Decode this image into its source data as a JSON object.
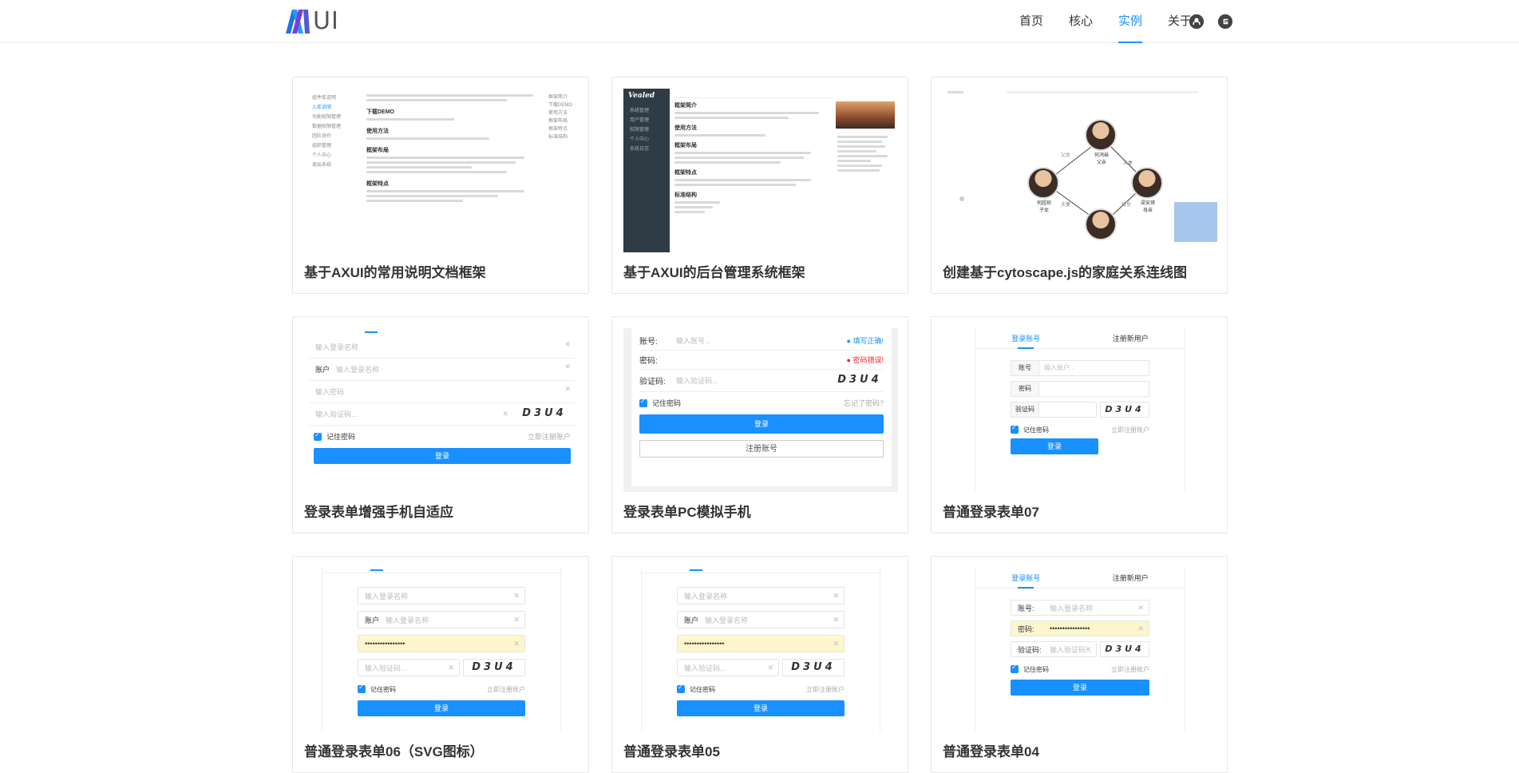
{
  "header": {
    "logo_text": "UI",
    "nav": [
      "首页",
      "核心",
      "实例",
      "关于"
    ],
    "active_nav": "实例"
  },
  "cards": [
    {
      "title": "基于AXUI的常用说明文档框架",
      "thumb": {
        "menu": [
          "组件库说明",
          "入库说明",
          "功能权限管理",
          "数据权限管理",
          "团队协作",
          "组织管理",
          "个人中心",
          "退出系统"
        ],
        "headings": [
          "下载DEMO",
          "使用方法",
          "框架布局",
          "框架特点"
        ],
        "right_menu": [
          "框架简介",
          "下载DEMO",
          "使用方法",
          "框架布局",
          "框架特点",
          "标准结构"
        ]
      }
    },
    {
      "title": "基于AXUI的后台管理系统框架",
      "thumb": {
        "brand": "Vealed",
        "headings": [
          "框架简介",
          "使用方法",
          "框架布局",
          "框架特点",
          "标准结构"
        ],
        "side_items": [
          "系统管理",
          "用户管理",
          "权限管理",
          "个人中心",
          "系统日志"
        ]
      }
    },
    {
      "title": "创建基于cytoscape.js的家庭关系连线图",
      "thumb": {
        "names": [
          "何鸿燊\n父亲",
          "何超琼\n子女",
          "梁安琪\n母亲"
        ],
        "edges": [
          "父女",
          "夫妻",
          "母女",
          "夫妻"
        ]
      }
    },
    {
      "title": "登录表单增强手机自适应",
      "thumb": {
        "fields": [
          "输入登录名称",
          "输入登录名称",
          "输入密码",
          "输入验证码..."
        ],
        "account_prefix": "账户",
        "captcha": "D3U4",
        "remember": "记住密码",
        "register": "立即注册账户",
        "login": "登录"
      }
    },
    {
      "title": "登录表单PC模拟手机",
      "thumb": {
        "labels": [
          "账号:",
          "密码:",
          "验证码:"
        ],
        "account_placeholder": "输入账号...",
        "captcha_placeholder": "输入验证码...",
        "ok_msg": "填写正确!",
        "err_msg": "密码错误!",
        "captcha": "D3U4",
        "remember": "记住密码",
        "forgot": "忘记了密码?",
        "login": "登录",
        "register": "注册账号"
      }
    },
    {
      "title": "普通登录表单07",
      "thumb": {
        "tabs": [
          "登录账号",
          "注册新用户"
        ],
        "labels": [
          "账号",
          "密码",
          "验证码"
        ],
        "account_placeholder": "输入账户...",
        "captcha": "D3U4",
        "remember": "记住密码",
        "register": "立即注册账户",
        "login": "登录"
      }
    },
    {
      "title": "普通登录表单06（SVG图标）",
      "thumb": {
        "fields": [
          "输入登录名称",
          "输入登录名称",
          "••••••••••••••••",
          "输入验证码..."
        ],
        "account_prefix": "账户",
        "captcha": "D3U4",
        "remember": "记住密码",
        "register": "立即注册账户",
        "login": "登录"
      }
    },
    {
      "title": "普通登录表单05",
      "thumb": {
        "fields": [
          "输入登录名称",
          "输入登录名称",
          "••••••••••••••••",
          "输入验证码..."
        ],
        "account_prefix": "账户",
        "captcha": "D3U4",
        "remember": "记住密码",
        "register": "立即注册账户",
        "login": "登录"
      }
    },
    {
      "title": "普通登录表单04",
      "thumb": {
        "tabs": [
          "登录账号",
          "注册新用户"
        ],
        "labels": [
          "账号:",
          "密码:",
          "验证码:"
        ],
        "account_placeholder": "输入登录名称",
        "password": "••••••••••••••••",
        "captcha_placeholder": "输入验证码...",
        "captcha": "D3U4",
        "remember": "记住密码",
        "register": "立即注册账户",
        "login": "登录"
      }
    }
  ]
}
